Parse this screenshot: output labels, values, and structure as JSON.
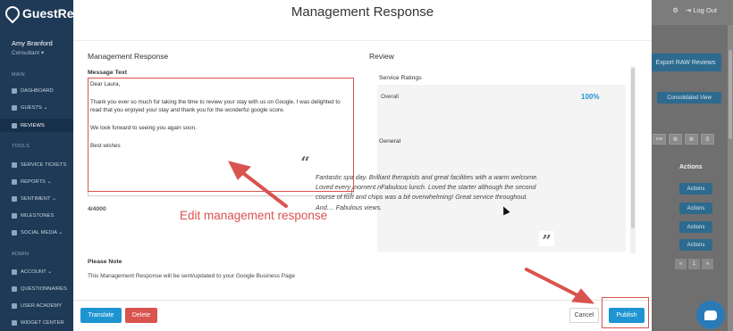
{
  "app": {
    "brand": "GuestRe"
  },
  "user": {
    "name": "Amy Branford",
    "role": "Consultant ▾"
  },
  "sidebar": {
    "section_main": "MAIN",
    "section_tools": "TOOLS",
    "section_admin": "ADMIN",
    "main_items": [
      {
        "label": "DASHBOARD"
      },
      {
        "label": "GUESTS ⌄"
      },
      {
        "label": "REVIEWS"
      }
    ],
    "tool_items": [
      {
        "label": "SERVICE TICKETS"
      },
      {
        "label": "REPORTS ⌄"
      },
      {
        "label": "SENTIMENT ⌄"
      },
      {
        "label": "MILESTONES"
      },
      {
        "label": "SOCIAL MEDIA ⌄"
      }
    ],
    "admin_items": [
      {
        "label": "ACCOUNT ⌄"
      },
      {
        "label": "QUESTIONNAIRES"
      },
      {
        "label": "USER ACADEMY"
      },
      {
        "label": "WIDGET CENTER"
      }
    ]
  },
  "topbar": {
    "logout_label": "Log Out"
  },
  "background": {
    "export_label": "Export RAW Reviews",
    "consolidated_label": "Consolidated View",
    "csv_label": "csv",
    "actions_header": "Actions",
    "actions_buttons": [
      "Actions",
      "Actions",
      "Actions",
      "Actions"
    ],
    "pager": [
      "«",
      "1",
      "»"
    ]
  },
  "modal": {
    "title": "Management Response",
    "left_title": "Management Response",
    "message_label": "Message Text",
    "message_text": "Dear Laura,\n\nThank you ever so much for taking the time to review your stay with us on Google. I was delighted to read that you enjoyed your stay and thank you for the wonderful google score.\n\nWe look forward to seeing you again soon.\n\nBest wishes",
    "char_count": "4/4000",
    "note_title": "Please Note",
    "note_text": "This Management Response will be sent/updated to your Google Business Page",
    "review_title": "Review",
    "service_ratings_title": "Service Ratings",
    "overall_label": "Overall",
    "overall_value": "100%",
    "general_title": "General",
    "review_text": "Fantastic spa day. Brilliant therapists and great facilities with a warm welcome. Loved every moment.nFabulous lunch. Loved the starter although the second course of fish and chips was a bit overwhelming! Great service throughout. And.... Fabulous views.",
    "translate_label": "Translate",
    "delete_label": "Delete",
    "cancel_label": "Cancel",
    "publish_label": "Publish"
  },
  "annotation": {
    "label": "Edit management response",
    "color": "#d9534f"
  },
  "colors": {
    "primary": "#1e95d2",
    "danger": "#d9534f",
    "sidebar": "#1f3a56"
  }
}
